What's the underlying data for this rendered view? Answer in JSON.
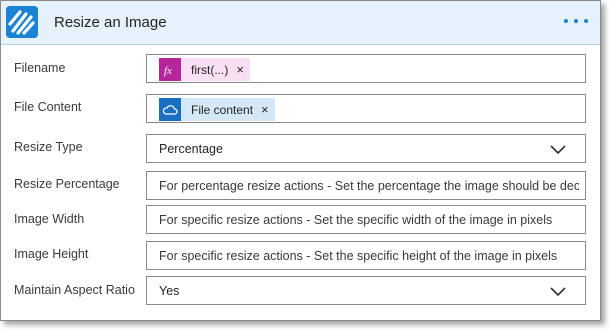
{
  "action": {
    "title": "Resize an Image",
    "logo_color": "#1b83d4",
    "menu_icon": "more-ellipsis-icon"
  },
  "fields": {
    "filename": {
      "label": "Filename",
      "token": {
        "icon": "fx-icon",
        "text": "first(...)",
        "color": "#b4259a",
        "bg": "#f8dff3"
      }
    },
    "file_content": {
      "label": "File Content",
      "token": {
        "icon": "cloud-icon",
        "text": "File content",
        "color": "#1b6fc2",
        "bg": "#d5e8f8"
      }
    },
    "resize_type": {
      "label": "Resize Type",
      "value": "Percentage"
    },
    "resize_percentage": {
      "label": "Resize Percentage",
      "placeholder": "For percentage resize actions - Set the percentage the image should be decrased by"
    },
    "image_width": {
      "label": "Image Width",
      "placeholder": "For specific resize actions - Set the specific width of the image in pixels"
    },
    "image_height": {
      "label": "Image Height",
      "placeholder": "For specific resize actions - Set the specific height of the image in pixels"
    },
    "maintain_aspect_ratio": {
      "label": "Maintain Aspect Ratio",
      "value": "Yes"
    }
  },
  "token_remove_glyph": "×"
}
